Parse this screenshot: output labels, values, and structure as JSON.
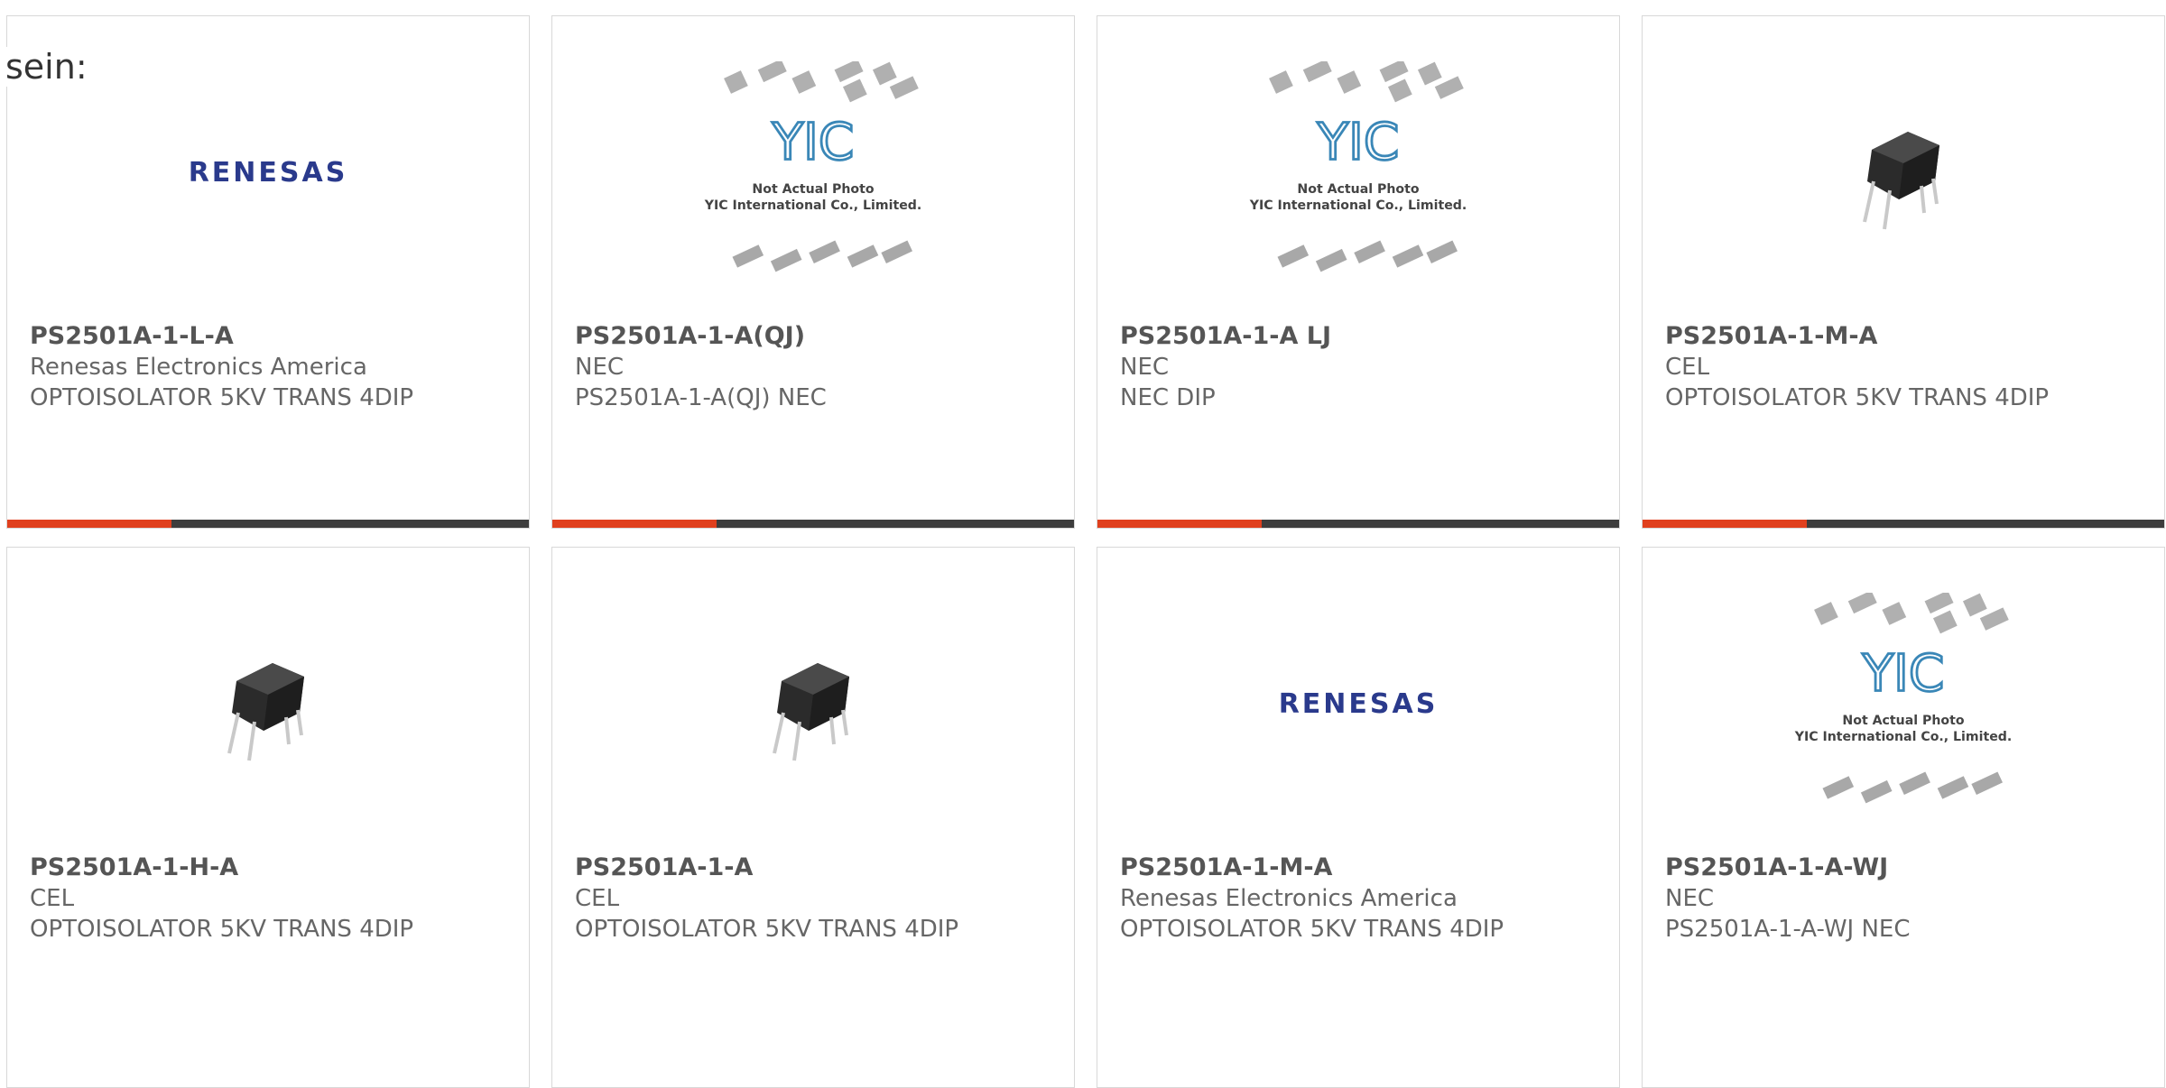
{
  "heading": "sein:",
  "rows": [
    [
      {
        "part": "PS2501A-1-L-A",
        "maker": "Renesas Electronics America",
        "desc": "OPTOISOLATOR 5KV TRANS 4DIP",
        "image": "renesas-logo"
      },
      {
        "part": "PS2501A-1-A(QJ)",
        "maker": "NEC",
        "desc": "PS2501A-1-A(QJ) NEC",
        "image": "yic-placeholder"
      },
      {
        "part": "PS2501A-1-A LJ",
        "maker": "NEC",
        "desc": "NEC DIP",
        "image": "yic-placeholder"
      },
      {
        "part": "PS2501A-1-M-A",
        "maker": "CEL",
        "desc": "OPTOISOLATOR 5KV TRANS 4DIP",
        "image": "dip-chip"
      }
    ],
    [
      {
        "part": "PS2501A-1-H-A",
        "maker": "CEL",
        "desc": "OPTOISOLATOR 5KV TRANS 4DIP",
        "image": "dip-chip"
      },
      {
        "part": "PS2501A-1-A",
        "maker": "CEL",
        "desc": "OPTOISOLATOR 5KV TRANS 4DIP",
        "image": "dip-chip"
      },
      {
        "part": "PS2501A-1-M-A",
        "maker": "Renesas Electronics America",
        "desc": "OPTOISOLATOR 5KV TRANS 4DIP",
        "image": "renesas-logo"
      },
      {
        "part": "PS2501A-1-A-WJ",
        "maker": "NEC",
        "desc": "PS2501A-1-A-WJ NEC",
        "image": "yic-placeholder"
      }
    ]
  ],
  "placeholder": {
    "line1": "Not Actual Photo",
    "line2": "YIC International Co., Limited.",
    "mark": "YIC"
  },
  "logo_text": "RENESAS",
  "colors": {
    "accent": "#e0401e",
    "bar": "#3d3d3d",
    "logo": "#2a3a8c"
  }
}
